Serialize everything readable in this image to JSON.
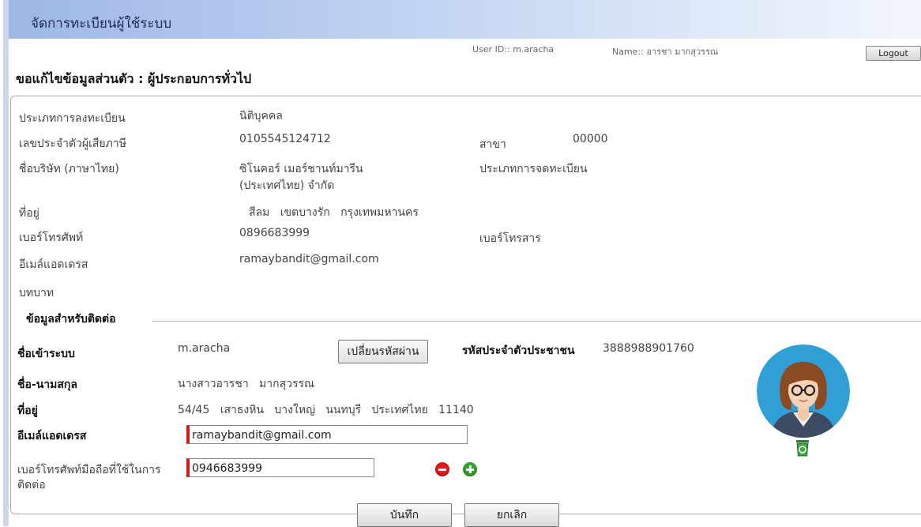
{
  "window": {
    "title": "จัดการทะเบียนผู้ใช้ระบบ"
  },
  "userbar": {
    "user_id": "User ID:: m.aracha",
    "name": "Name:: อารชา มากสุวรรณ",
    "logout_label": "Logout"
  },
  "page": {
    "title": "ขอแก้ไขข้อมูลส่วนตัว : ผู้ประกอบการทั่วไป"
  },
  "company": {
    "reg_type_label": "ประเภทการลงทะเบียน",
    "reg_type_value": "นิติบุคคล",
    "tax_id_label": "เลขประจำตัวผู้เสียภาษี",
    "tax_id_value": "0105545124712",
    "branch_label": "สาขา",
    "branch_value": "00000",
    "name_label": "ชื่อบริษัท (ภาษาไทย)",
    "name_value_line1": "ซิโนคอร์ เมอร์ชานท์มารีน",
    "name_value_line2": "(ประเทศไทย) จำกัด",
    "register_type_label": "ประเภทการจดทะเบียน",
    "address_label": "ที่อยู่",
    "address_value": "สีลม   เขตบางรัก   กรุงเทพมหานคร",
    "phone_label": "เบอร์โทรศัพท์",
    "phone_value": "0896683999",
    "fax_label": "เบอร์โทรสาร",
    "email_label": "อีเมล์แอดเดรส",
    "email_value": "ramaybandit@gmail.com",
    "role_label": "บทบาท"
  },
  "contact": {
    "section_title": "ข้อมูลสำหรับติดต่อ",
    "login_label": "ชื่อเข้าระบบ",
    "login_value": "m.aracha",
    "change_password_label": "เปลี่ยนรหัสผ่าน",
    "citizen_id_label": "รหัสประจำตัวประชาชน",
    "citizen_id_value": "3888988901760",
    "fullname_label": "ชื่อ-นามสกุล",
    "fullname_value": "นางสาวอารชา   มากสุวรรณ",
    "address_label": "ที่อยู่",
    "address_value": "54/45   เสาธงหิน   บางใหญ่   นนทบุรี   ประเทศไทย   11140",
    "email_label": "อีเมล์แอดเดรส",
    "email_value": "ramaybandit@gmail.com",
    "mobile_label_line1": "เบอร์โทรศัพท์มือถือที่ใช้ในการ",
    "mobile_label_line2": "ติดต่อ",
    "mobile_value": "0946683999"
  },
  "actions": {
    "save_label": "บันทึก",
    "cancel_label": "ยกเลิก"
  },
  "icons": {
    "remove": "minus-circle-icon",
    "add": "plus-circle-icon",
    "avatar": "user-avatar",
    "delete_photo": "trash-icon"
  },
  "colors": {
    "header_gradient_start": "#9db7e6",
    "required_marker": "#d11a1a",
    "remove_button": "#e01b1b",
    "add_button": "#35a52c",
    "avatar_bg": "#2f9fd6"
  }
}
